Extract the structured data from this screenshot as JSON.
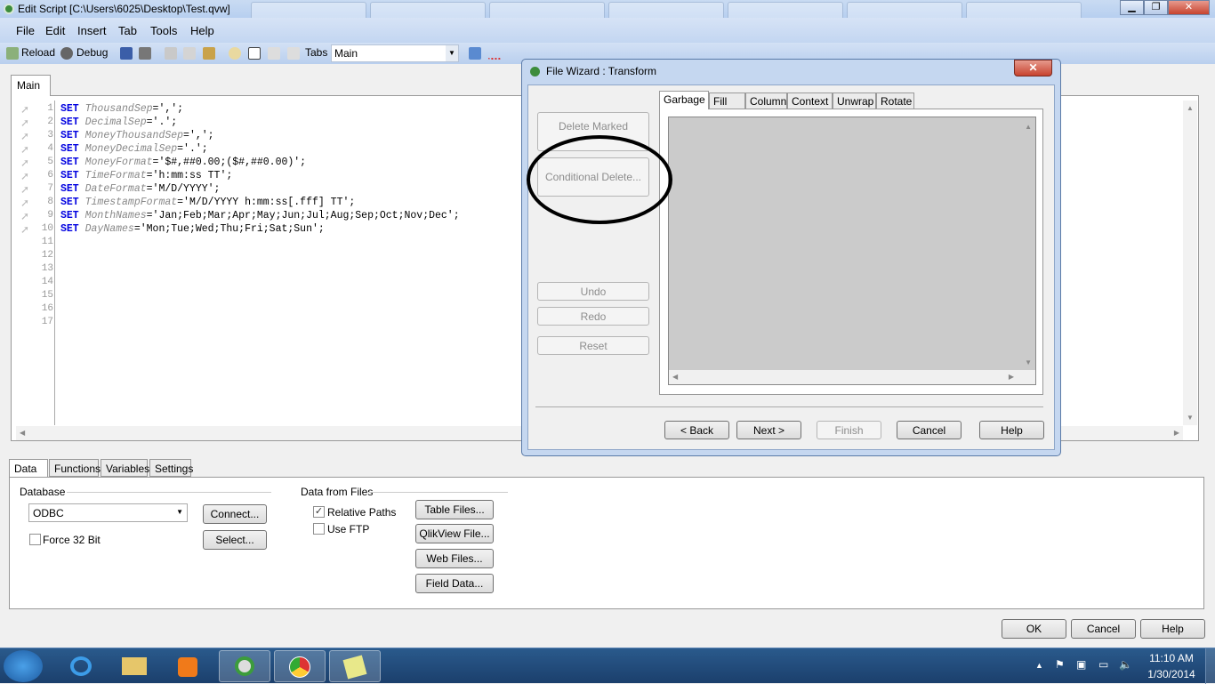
{
  "window": {
    "title": "Edit Script [C:\\Users\\6025\\Desktop\\Test.qvw]",
    "minimize": "▁",
    "maximize": "❐",
    "close": "✕"
  },
  "menu": [
    "File",
    "Edit",
    "Insert",
    "Tab",
    "Tools",
    "Help"
  ],
  "toolbar": {
    "reload": "Reload",
    "debug": "Debug",
    "tabs_label": "Tabs",
    "tabs_value": "Main"
  },
  "editor": {
    "tab": "Main",
    "line_numbers": [
      "1",
      "2",
      "3",
      "4",
      "5",
      "6",
      "7",
      "8",
      "9",
      "10",
      "11",
      "12",
      "13",
      "14",
      "15",
      "16",
      "17"
    ],
    "lines": [
      {
        "kw": "SET",
        "var": "ThousandSep",
        "val": "=',';"
      },
      {
        "kw": "SET",
        "var": "DecimalSep",
        "val": "='.';"
      },
      {
        "kw": "SET",
        "var": "MoneyThousandSep",
        "val": "=',';"
      },
      {
        "kw": "SET",
        "var": "MoneyDecimalSep",
        "val": "='.';"
      },
      {
        "kw": "SET",
        "var": "MoneyFormat",
        "val": "='$#,##0.00;($#,##0.00)';"
      },
      {
        "kw": "SET",
        "var": "TimeFormat",
        "val": "='h:mm:ss TT';"
      },
      {
        "kw": "SET",
        "var": "DateFormat",
        "val": "='M/D/YYYY';"
      },
      {
        "kw": "SET",
        "var": "TimestampFormat",
        "val": "='M/D/YYYY h:mm:ss[.fff] TT';"
      },
      {
        "kw": "SET",
        "var": "MonthNames",
        "val": "='Jan;Feb;Mar;Apr;May;Jun;Jul;Aug;Sep;Oct;Nov;Dec';"
      },
      {
        "kw": "SET",
        "var": "DayNames",
        "val": "='Mon;Tue;Wed;Thu;Fri;Sat;Sun';"
      }
    ]
  },
  "bottom": {
    "tabs": [
      "Data",
      "Functions",
      "Variables",
      "Settings"
    ],
    "database_label": "Database",
    "database_value": "ODBC",
    "connect": "Connect...",
    "select": "Select...",
    "force32": "Force 32 Bit",
    "files_label": "Data from Files",
    "relative_paths": "Relative Paths",
    "relative_paths_checked": true,
    "use_ftp": "Use FTP",
    "use_ftp_checked": false,
    "table_files": "Table Files...",
    "qlikview_file": "QlikView File...",
    "web_files": "Web Files...",
    "field_data": "Field Data..."
  },
  "footer": {
    "ok": "OK",
    "cancel": "Cancel",
    "help": "Help"
  },
  "dialog": {
    "title": "File Wizard : Transform",
    "close": "✕",
    "delete_marked": "Delete Marked",
    "conditional_delete": "Conditional Delete...",
    "undo": "Undo",
    "redo": "Redo",
    "reset": "Reset",
    "tabs": [
      "Garbage",
      "Fill",
      "Column",
      "Context",
      "Unwrap",
      "Rotate"
    ],
    "back": "< Back",
    "next": "Next >",
    "finish": "Finish",
    "cancel": "Cancel",
    "help": "Help"
  },
  "taskbar": {
    "time": "11:10 AM",
    "date": "1/30/2014"
  }
}
